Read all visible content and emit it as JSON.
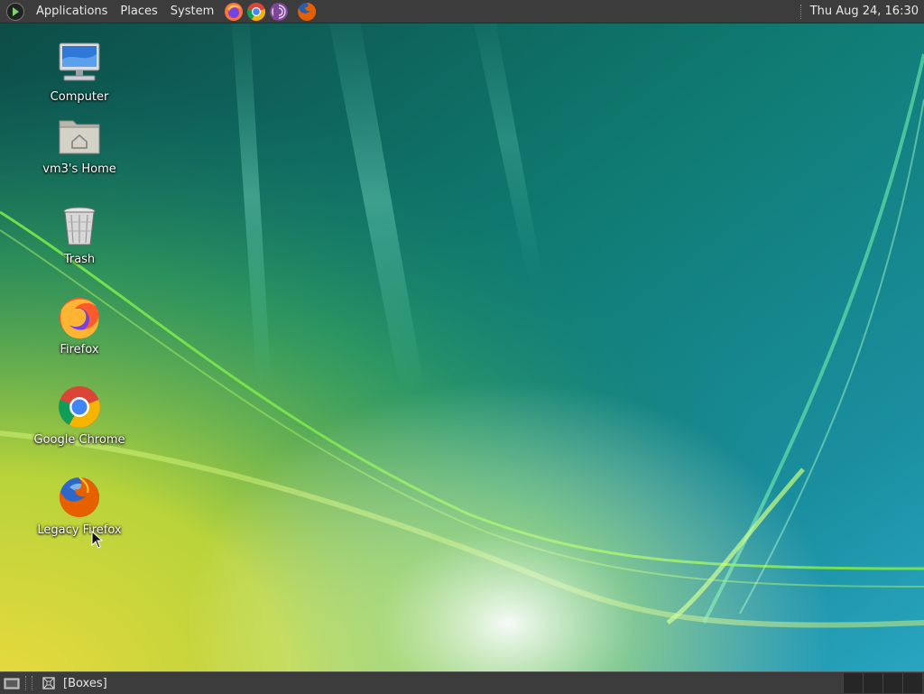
{
  "top_panel": {
    "menus": [
      "Applications",
      "Places",
      "System"
    ],
    "launchers": [
      "firefox-icon",
      "chrome-icon",
      "tor-icon",
      "firefox-legacy-icon"
    ],
    "clock": "Thu Aug 24, 16:30"
  },
  "desktop_icons": [
    {
      "label": "Computer",
      "icon": "computer-icon"
    },
    {
      "label": "vm3's Home",
      "icon": "home-folder-icon"
    },
    {
      "label": "Trash",
      "icon": "trash-icon"
    },
    {
      "label": "Firefox",
      "icon": "firefox-icon"
    },
    {
      "label": "Google Chrome",
      "icon": "chrome-icon"
    },
    {
      "label": "Legacy Firefox",
      "icon": "firefox-legacy-icon"
    }
  ],
  "bottom_panel": {
    "task_label": "[Boxes]"
  },
  "colors": {
    "panel": "#3c3c3c",
    "wallpaper_teal": "#0a6b6b",
    "wallpaper_green": "#8ed43a",
    "wallpaper_yellow": "#e6d640"
  }
}
